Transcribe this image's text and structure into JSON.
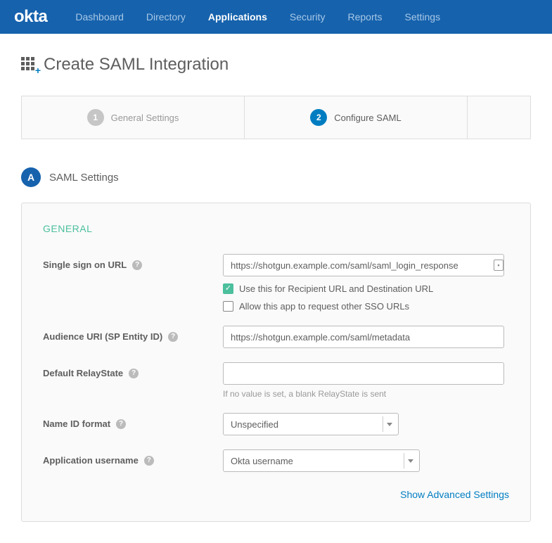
{
  "logo": "okta",
  "nav": {
    "items": [
      {
        "label": "Dashboard",
        "active": false
      },
      {
        "label": "Directory",
        "active": false
      },
      {
        "label": "Applications",
        "active": true
      },
      {
        "label": "Security",
        "active": false
      },
      {
        "label": "Reports",
        "active": false
      },
      {
        "label": "Settings",
        "active": false
      }
    ]
  },
  "page_title": "Create SAML Integration",
  "wizard": {
    "steps": [
      {
        "num": "1",
        "label": "General Settings",
        "active": false
      },
      {
        "num": "2",
        "label": "Configure SAML",
        "active": true
      }
    ]
  },
  "section": {
    "badge": "A",
    "title": "SAML Settings"
  },
  "form": {
    "heading": "GENERAL",
    "sso_url_label": "Single sign on URL",
    "sso_url_value": "https://shotgun.example.com/saml/saml_login_response",
    "sso_recipient_checkbox_label": "Use this for Recipient URL and Destination URL",
    "sso_other_urls_checkbox_label": "Allow this app to request other SSO URLs",
    "audience_label": "Audience URI (SP Entity ID)",
    "audience_value": "https://shotgun.example.com/saml/metadata",
    "relaystate_label": "Default RelayState",
    "relaystate_value": "",
    "relaystate_hint": "If no value is set, a blank RelayState is sent",
    "nameid_label": "Name ID format",
    "nameid_value": "Unspecified",
    "appuser_label": "Application username",
    "appuser_value": "Okta username",
    "advanced_link": "Show Advanced Settings"
  }
}
